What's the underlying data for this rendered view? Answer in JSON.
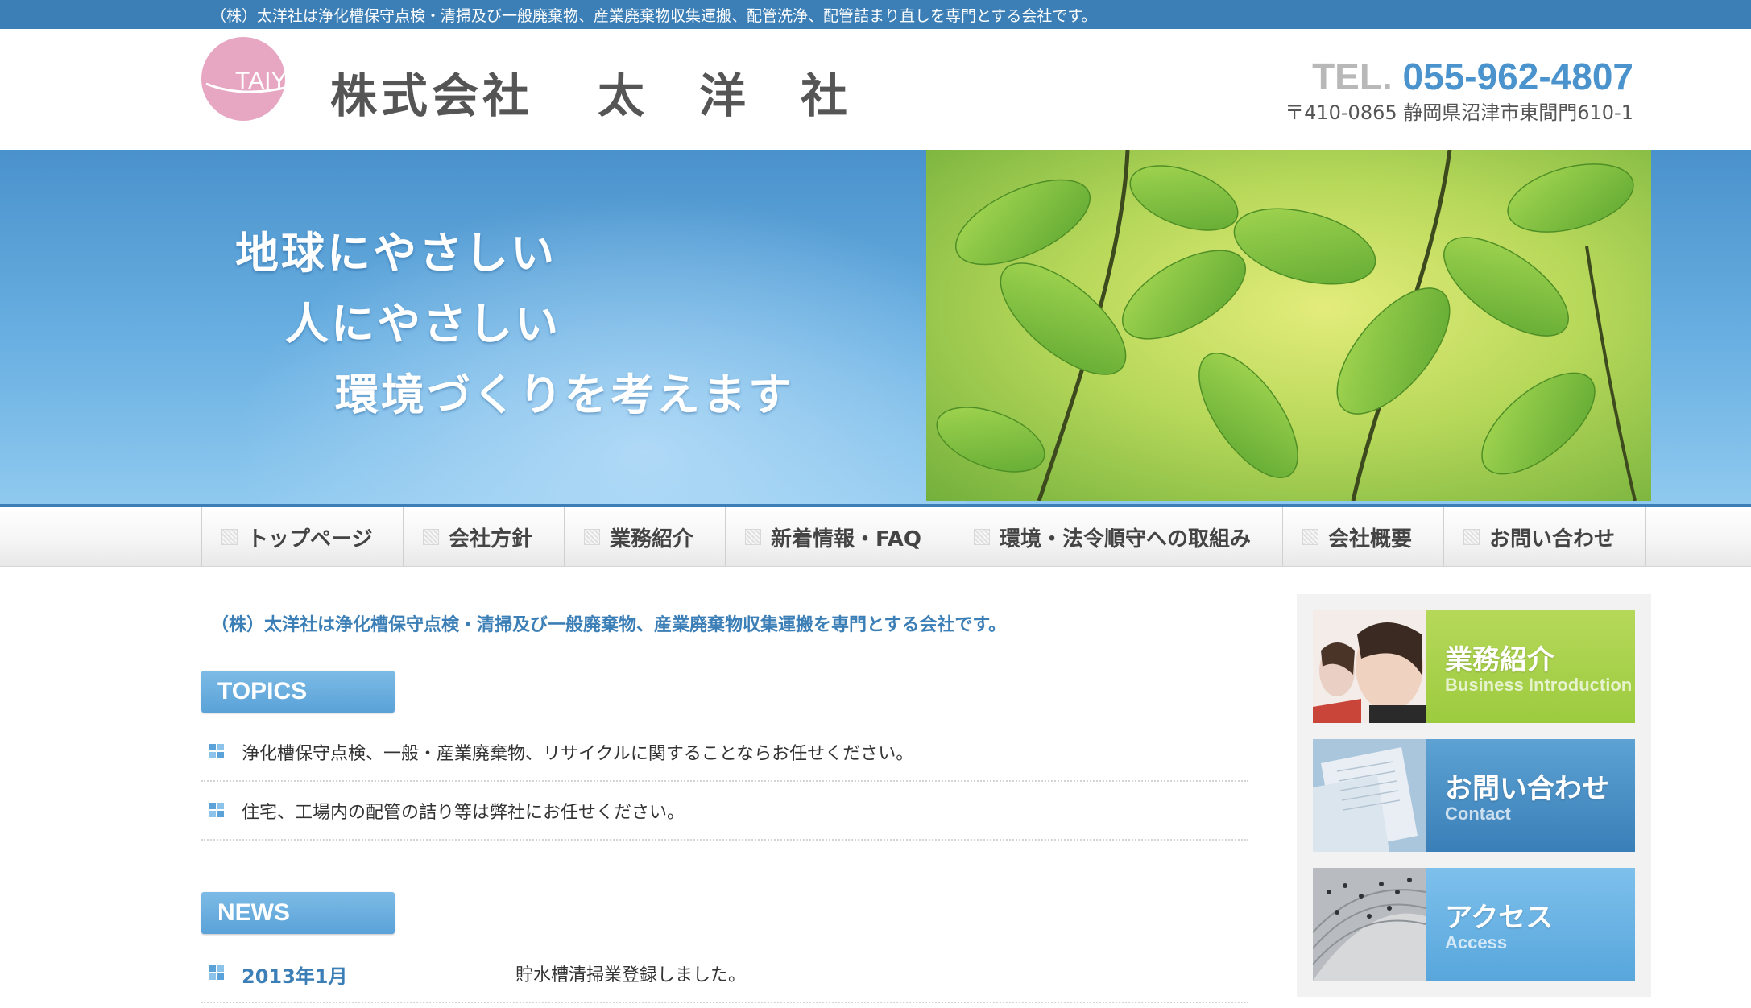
{
  "top_strip": {
    "text": "（株）太洋社は浄化槽保守点検・清掃及び一般廃棄物、産業廃棄物収集運搬、配管洗浄、配管詰まり直しを専門とする会社です。"
  },
  "header": {
    "logo_mark_text": "TAIYO",
    "company_name_a": "株式会社",
    "company_name_b": "太　洋　社",
    "tel_label": "TEL.",
    "tel_number": "055-962-4807",
    "address": "〒410-0865 静岡県沼津市東間門610-1"
  },
  "hero": {
    "slogan_line_1": "地球にやさしい",
    "slogan_line_2": "人にやさしい",
    "slogan_line_3": "環境づくりを考えます"
  },
  "nav": {
    "items": [
      {
        "label": "トップページ"
      },
      {
        "label": "会社方針"
      },
      {
        "label": "業務紹介"
      },
      {
        "label": "新着情報・FAQ"
      },
      {
        "label": "環境・法令順守への取組み"
      },
      {
        "label": "会社概要"
      },
      {
        "label": "お問い合わせ"
      }
    ]
  },
  "main": {
    "intro": "（株）太洋社は浄化槽保守点検・清掃及び一般廃棄物、産業廃棄物収集運搬を専門とする会社です。",
    "topics": {
      "label": "TOPICS",
      "items": [
        {
          "text": "浄化槽保守点検、一般・産業廃棄物、リサイクルに関することならお任せください。"
        },
        {
          "text": "住宅、工場内の配管の詰り等は弊社にお任せください。"
        }
      ]
    },
    "news": {
      "label": "NEWS",
      "items": [
        {
          "date": "2013年1月",
          "text": "貯水槽清掃業登録しました。"
        }
      ]
    }
  },
  "sidebar": {
    "banners": [
      {
        "title": "業務紹介",
        "subtitle": "Business Introduction"
      },
      {
        "title": "お問い合わせ",
        "subtitle": "Contact"
      },
      {
        "title": "アクセス",
        "subtitle": "Access"
      }
    ]
  },
  "colors": {
    "brand_blue": "#3c7fb6",
    "tel_blue": "#4a93cc",
    "logo_pink": "#e7a6c2",
    "banner_green": "#9ccb3f"
  }
}
